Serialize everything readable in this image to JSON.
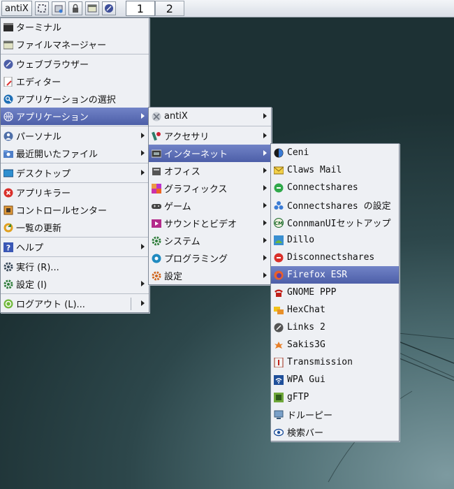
{
  "taskbar": {
    "start_label": "antiX",
    "launchers": [
      "fullscreen-icon",
      "remove-disk-icon",
      "lock-icon",
      "file-manager-icon",
      "browser-icon"
    ],
    "workspaces": [
      "1",
      "2"
    ]
  },
  "main_menu": {
    "items": [
      {
        "label": "ターミナル",
        "icon": "terminal-icon"
      },
      {
        "label": "ファイルマネージャー",
        "icon": "file-manager-icon"
      },
      {
        "label": "ウェブブラウザー",
        "icon": "browser-icon"
      },
      {
        "label": "エディター",
        "icon": "editor-icon"
      },
      {
        "label": "アプリケーションの選択",
        "icon": "search-icon"
      },
      {
        "label": "アプリケーション",
        "icon": "applications-icon"
      },
      {
        "label": "パーソナル",
        "icon": "personal-icon"
      },
      {
        "label": "最近開いたファイル",
        "icon": "recent-files-icon"
      },
      {
        "label": "デスクトップ",
        "icon": "desktop-icon"
      },
      {
        "label": "アプリキラー",
        "icon": "app-killer-icon"
      },
      {
        "label": "コントロールセンター",
        "icon": "control-center-icon"
      },
      {
        "label": "一覧の更新",
        "icon": "refresh-icon"
      },
      {
        "label": "ヘルプ",
        "icon": "help-icon"
      },
      {
        "label": "実行 (R)...",
        "icon": "run-icon"
      },
      {
        "label": "設定 (I)",
        "icon": "settings-icon"
      },
      {
        "label": "ログアウト (L)...",
        "icon": "logout-icon"
      }
    ]
  },
  "apps_menu": {
    "items": [
      {
        "label": "antiX",
        "icon": "antix-icon"
      },
      {
        "label": "アクセサリ",
        "icon": "accessories-icon"
      },
      {
        "label": "インターネット",
        "icon": "internet-icon"
      },
      {
        "label": "オフィス",
        "icon": "office-icon"
      },
      {
        "label": "グラフィックス",
        "icon": "graphics-icon"
      },
      {
        "label": "ゲーム",
        "icon": "games-icon"
      },
      {
        "label": "サウンドとビデオ",
        "icon": "multimedia-icon"
      },
      {
        "label": "システム",
        "icon": "system-icon"
      },
      {
        "label": "プログラミング",
        "icon": "programming-icon"
      },
      {
        "label": "設定",
        "icon": "settings-icon"
      }
    ]
  },
  "internet_menu": {
    "items": [
      {
        "label": "Ceni",
        "icon": "ceni-icon"
      },
      {
        "label": "Claws Mail",
        "icon": "mail-icon"
      },
      {
        "label": "Connectshares",
        "icon": "connectshares-icon"
      },
      {
        "label": "Connectshares の設定",
        "icon": "connectshares-config-icon"
      },
      {
        "label": "ConnmanUIセットアップ",
        "icon": "connman-icon"
      },
      {
        "label": "Dillo",
        "icon": "dillo-icon"
      },
      {
        "label": "Disconnectshares",
        "icon": "disconnect-icon"
      },
      {
        "label": "Firefox ESR",
        "icon": "firefox-icon"
      },
      {
        "label": "GNOME PPP",
        "icon": "phone-icon"
      },
      {
        "label": "HexChat",
        "icon": "hexchat-icon"
      },
      {
        "label": "Links 2",
        "icon": "links-icon"
      },
      {
        "label": "Sakis3G",
        "icon": "sakis-icon"
      },
      {
        "label": "Transmission",
        "icon": "transmission-icon"
      },
      {
        "label": "WPA Gui",
        "icon": "wifi-icon"
      },
      {
        "label": "gFTP",
        "icon": "ftp-icon"
      },
      {
        "label": "ドルーピー",
        "icon": "droopy-icon"
      },
      {
        "label": "検索バー",
        "icon": "search-bar-icon"
      }
    ]
  },
  "colors": {
    "highlight": "#5a6bb3",
    "menu_bg": "#eef0f4"
  }
}
